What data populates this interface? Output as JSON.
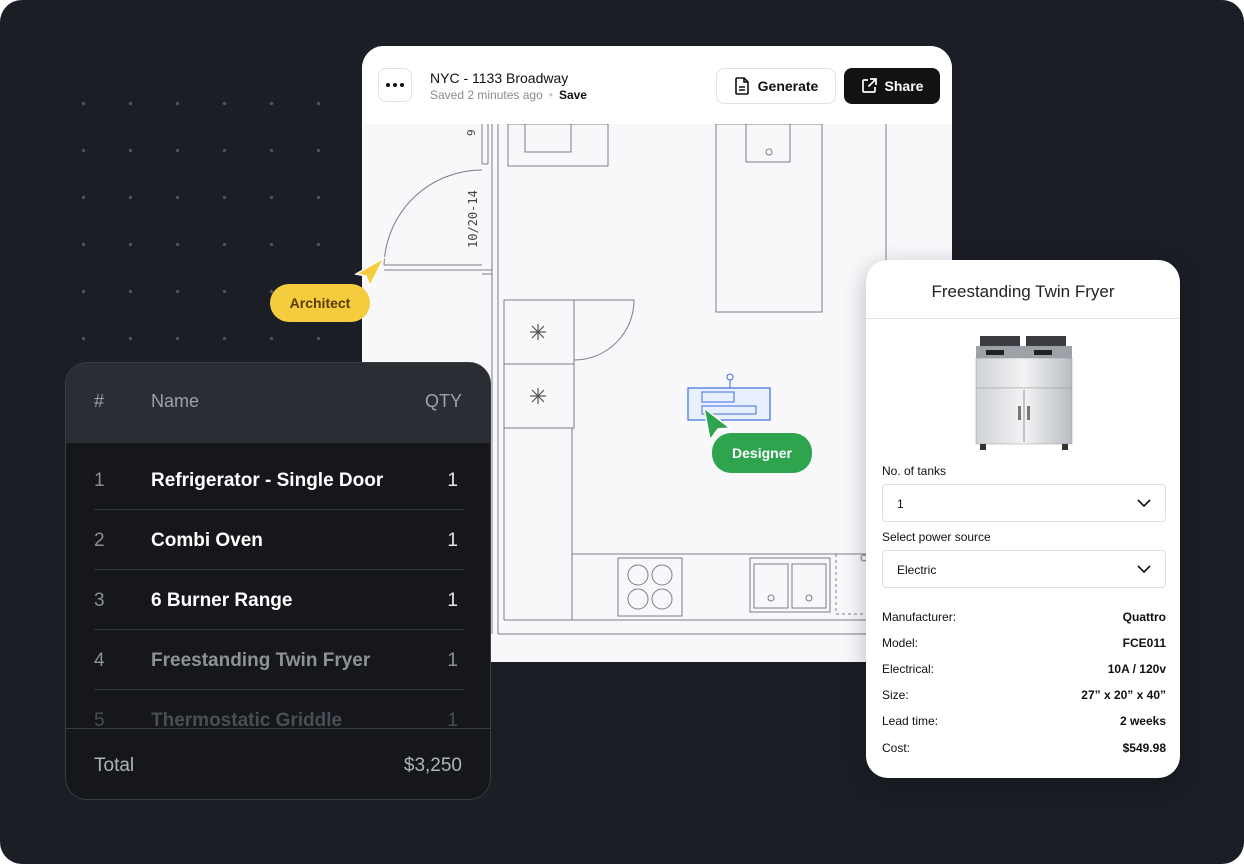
{
  "document": {
    "title": "NYC - 1133 Broadway",
    "saved_status": "Saved 2 minutes ago",
    "save_label": "Save",
    "generate_label": "Generate",
    "share_label": "Share"
  },
  "floor_plan": {
    "dimension_label": "10/20-14",
    "dimension_label_top": "9"
  },
  "collaborators": {
    "architect": "Architect",
    "designer": "Designer"
  },
  "item_list": {
    "headers": {
      "number": "#",
      "name": "Name",
      "qty": "QTY"
    },
    "rows": [
      {
        "number": "1",
        "name": "Refrigerator - Single Door",
        "qty": "1"
      },
      {
        "number": "2",
        "name": "Combi Oven",
        "qty": "1"
      },
      {
        "number": "3",
        "name": "6 Burner Range",
        "qty": "1"
      },
      {
        "number": "4",
        "name": "Freestanding Twin Fryer",
        "qty": "1"
      },
      {
        "number": "5",
        "name": "Thermostatic Griddle",
        "qty": "1"
      }
    ],
    "total_label": "Total",
    "total_value": "$3,250"
  },
  "product": {
    "title": "Freestanding Twin Fryer",
    "tanks_label": "No. of tanks",
    "tanks_value": "1",
    "power_label": "Select power source",
    "power_value": "Electric",
    "specs": {
      "manufacturer_label": "Manufacturer:",
      "manufacturer": "Quattro",
      "model_label": "Model:",
      "model": "FCE011",
      "electrical_label": "Electrical:",
      "electrical": "10A / 120v",
      "size_label": "Size:",
      "size": "27” x 20” x 40”",
      "lead_time_label": "Lead time:",
      "lead_time": "2 weeks",
      "cost_label": "Cost:",
      "cost": "$549.98"
    }
  },
  "colors": {
    "background": "#1b1e25",
    "architect": "#f6cc3f",
    "designer": "#2ea44f",
    "selection": "#3b6fd8"
  }
}
